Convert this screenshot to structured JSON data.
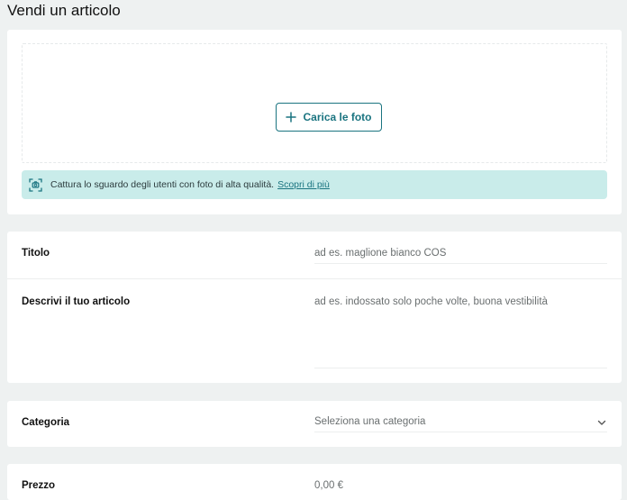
{
  "page": {
    "title": "Vendi un articolo"
  },
  "photos": {
    "upload_label": "Carica le foto",
    "tip_text": "Cattura lo sguardo degli utenti con foto di alta qualità.",
    "tip_link": "Scopri di più",
    "icons": {
      "upload": "plus-icon",
      "tip": "camera-focus-icon"
    }
  },
  "details": {
    "title_label": "Titolo",
    "title_placeholder": "ad es. maglione bianco COS",
    "description_label": "Descrivi il tuo articolo",
    "description_placeholder": "ad es. indossato solo poche volte, buona vestibilità"
  },
  "category": {
    "label": "Categoria",
    "placeholder": "Seleziona una categoria",
    "icon": "chevron-down-icon"
  },
  "price": {
    "label": "Prezzo",
    "placeholder": "0,00 €"
  },
  "colors": {
    "background": "#eef1f1",
    "accent": "#1a7480",
    "tip_background": "#c9ecea"
  }
}
